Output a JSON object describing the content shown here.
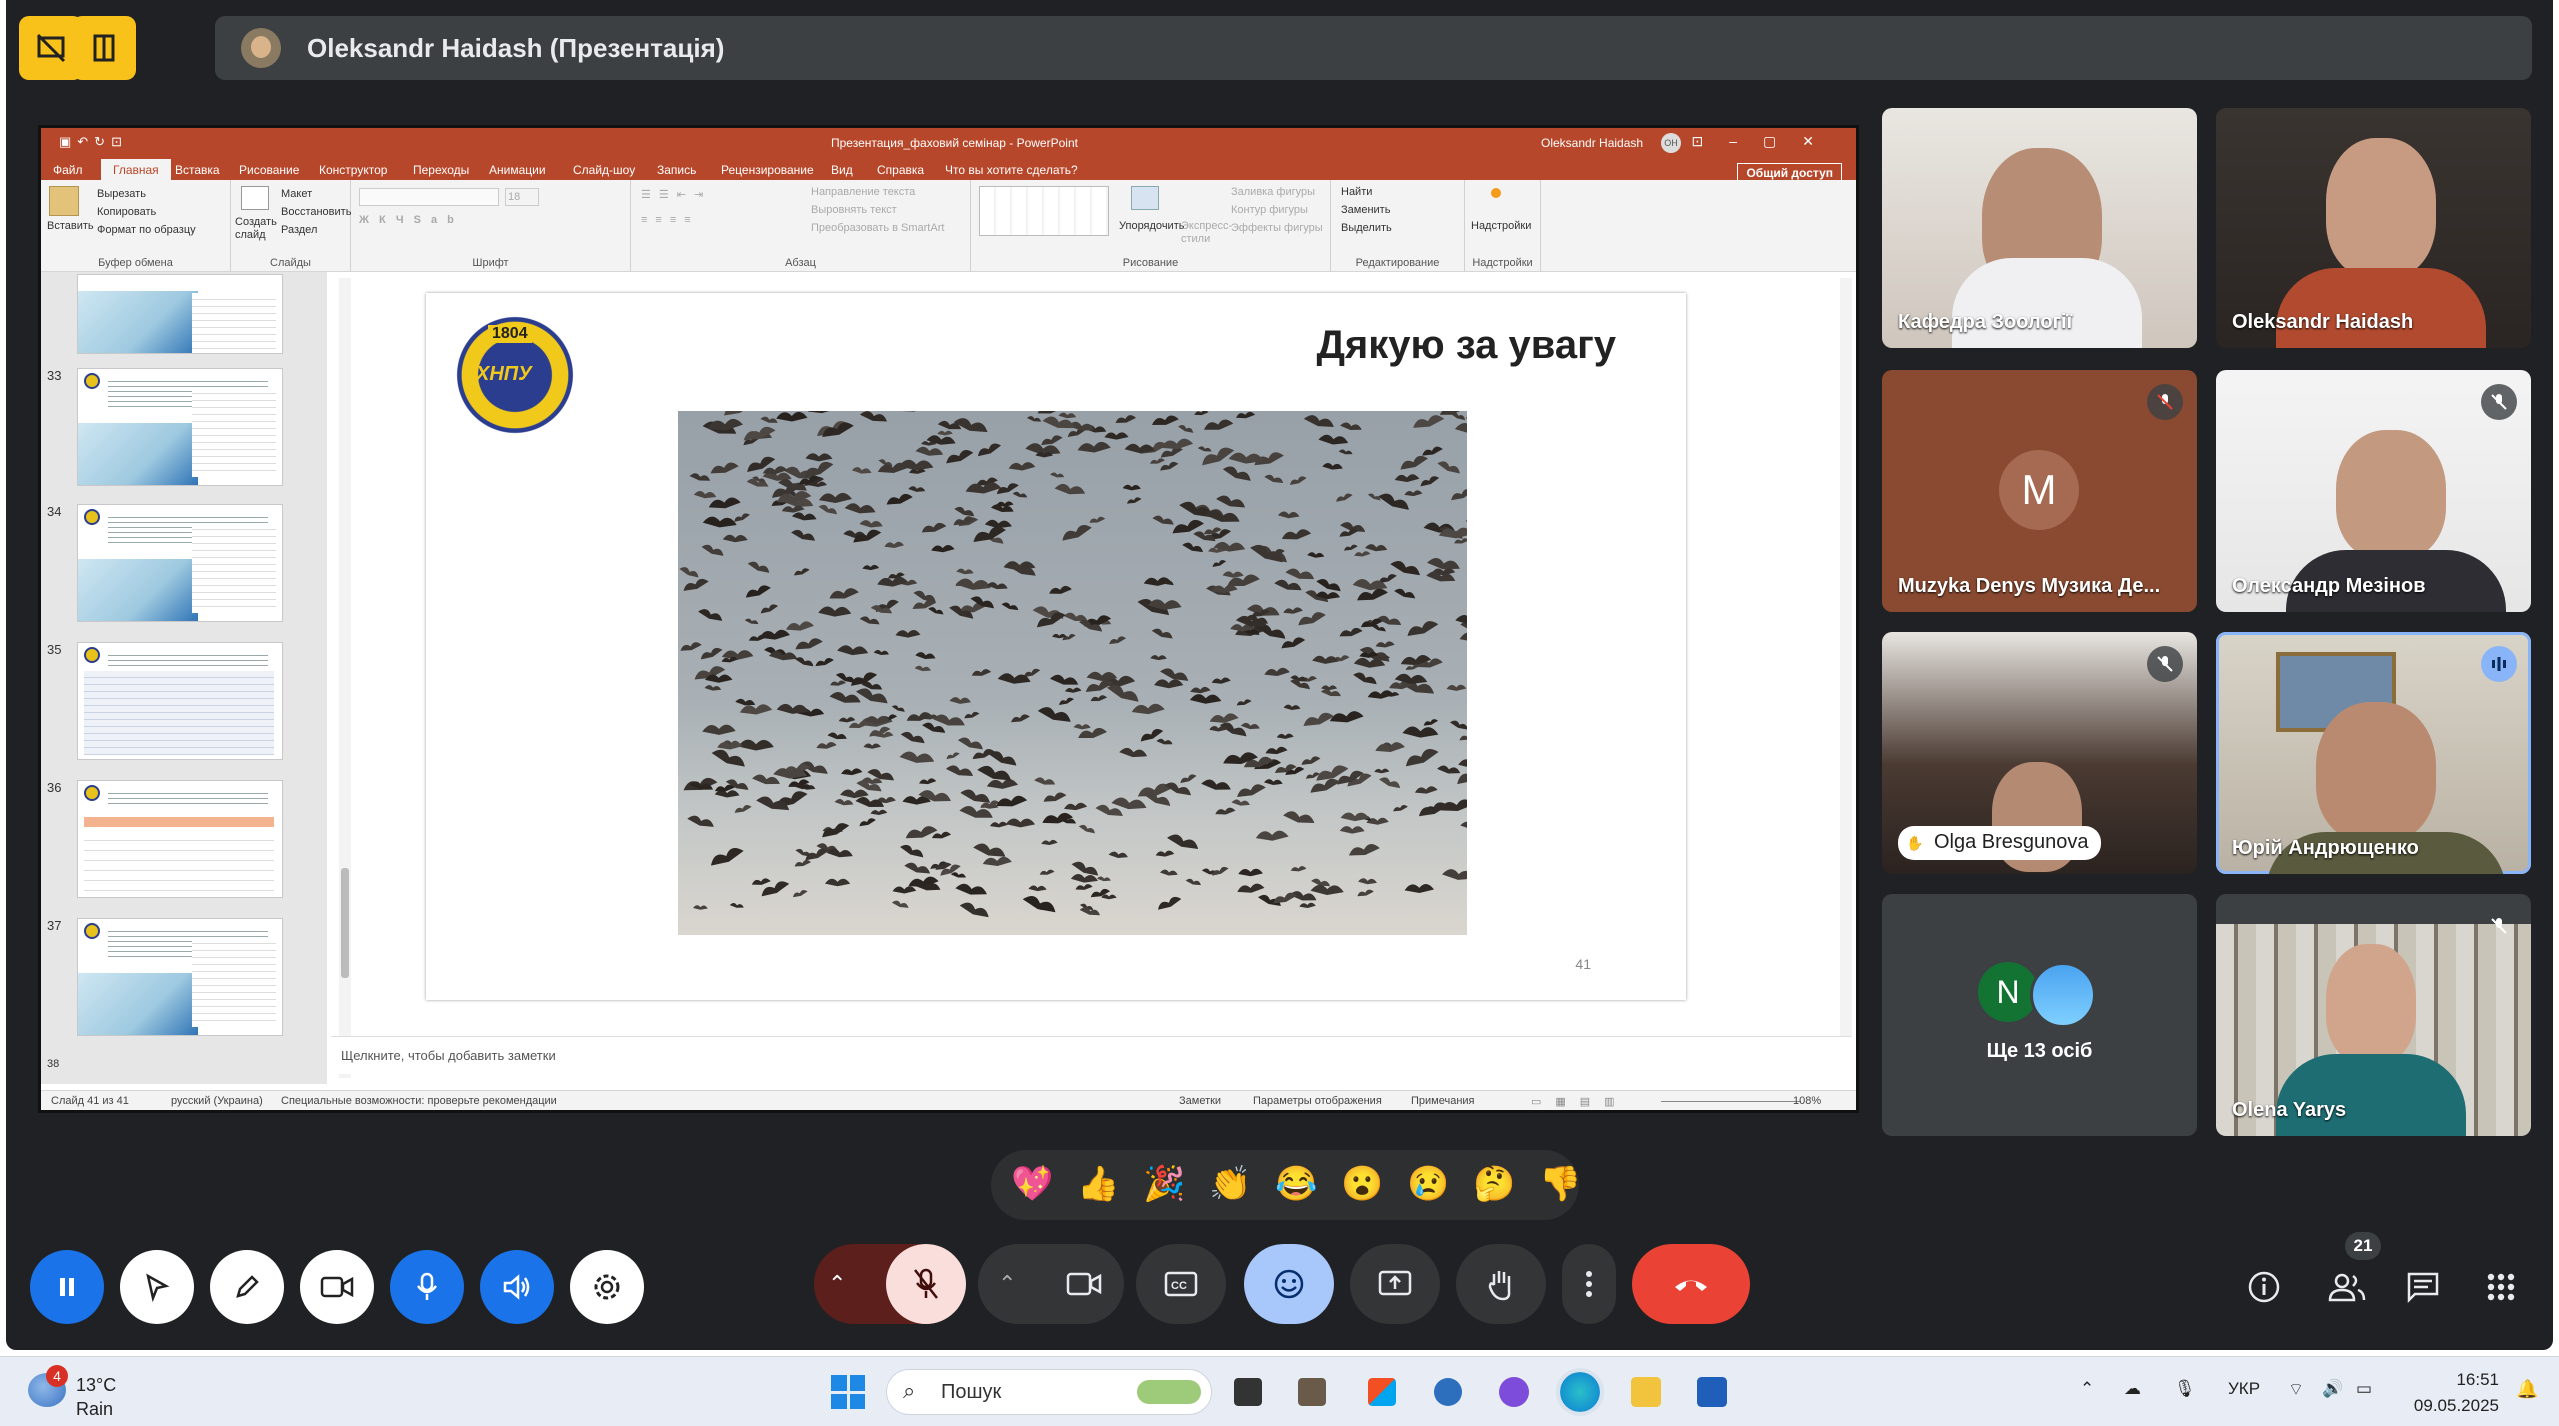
{
  "meet": {
    "presenter_label": "Oleksandr Haidash (Презентація)",
    "participants": [
      {
        "name": "Кафедра Зоології",
        "muted": false
      },
      {
        "name": "Oleksandr Haidash",
        "muted": false
      },
      {
        "name": "Muzyka Denys Музика Де...",
        "initial": "M",
        "muted": true
      },
      {
        "name": "Олександр Мезінов",
        "muted": true
      },
      {
        "name": "Olga Bresgunova",
        "muted": true,
        "hand_raised": true
      },
      {
        "name": "Юрій Андрющенко",
        "speaking": true
      },
      {
        "name": "Ще 13 осіб",
        "initial": "N"
      },
      {
        "name": "Olena Yarys",
        "muted": true
      }
    ],
    "reactions": [
      "💖",
      "👍",
      "🎉",
      "👏",
      "😂",
      "😮",
      "😢",
      "🤔",
      "👎"
    ],
    "people_count": "21",
    "accent_color": "#8ab4f8",
    "end_call_color": "#ea4335"
  },
  "ppt": {
    "window_title": "Презентация_фаховий семінар - PowerPoint",
    "user_name": "Oleksandr Haidash",
    "user_initials": "OH",
    "tabs": [
      "Файл",
      "Главная",
      "Вставка",
      "Рисование",
      "Конструктор",
      "Переходы",
      "Анимации",
      "Слайд-шоу",
      "Запись",
      "Рецензирование",
      "Вид",
      "Справка",
      "Что вы хотите сделать?"
    ],
    "share": "Общий доступ",
    "ribbon": {
      "paste": "Вставить",
      "cut": "Вырезать",
      "copy": "Копировать",
      "format_painter": "Формат по образцу",
      "clipboard": "Буфер обмена",
      "new_slide": "Создать слайд",
      "layout": "Макет",
      "reset": "Восстановить",
      "section": "Раздел",
      "slides": "Слайды",
      "font": "Шрифт",
      "font_size": "18",
      "text_direction": "Направление текста",
      "align_text": "Выровнять текст",
      "smartart": "Преобразовать в SmartArt",
      "paragraph": "Абзац",
      "arrange": "Упорядочить",
      "quick_styles": "Экспресс-стили",
      "shape_fill": "Заливка фигуры",
      "shape_outline": "Контур фигуры",
      "shape_effects": "Эффекты фигуры",
      "drawing": "Рисование",
      "find": "Найти",
      "replace": "Заменить",
      "select": "Выделить",
      "editing": "Редактирование",
      "addins": "Надстройки",
      "addins_group": "Надстройки"
    },
    "thumbs": [
      "33",
      "34",
      "35",
      "36",
      "37",
      "38"
    ],
    "slide": {
      "title": "Дякую за увагу",
      "number": "41",
      "logo_year": "1804",
      "logo_abbr": "ХНПУ"
    },
    "notes_placeholder": "Щелкните, чтобы добавить заметки",
    "status": {
      "slide_of": "Слайд 41 из 41",
      "language": "русский (Украина)",
      "accessibility": "Специальные возможности: проверьте рекомендации",
      "notes": "Заметки",
      "display": "Параметры отображения",
      "comments": "Примечания",
      "zoom": "108%"
    }
  },
  "taskbar": {
    "weather_temp": "13°C",
    "weather_desc": "Rain",
    "weather_badge": "4",
    "search_placeholder": "Пошук",
    "language": "УКР",
    "time": "16:51",
    "date": "09.05.2025"
  }
}
